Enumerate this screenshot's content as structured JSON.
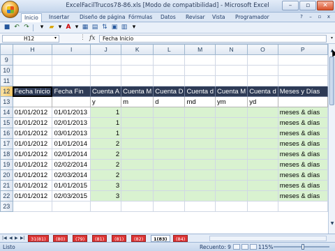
{
  "window": {
    "title": "ExcelFacilTrucos78-86.xls  [Modo de compatibilidad]  -  Microsoft Excel"
  },
  "ribbon": {
    "tabs": [
      "Inicio",
      "Insertar",
      "Diseño de página",
      "Fórmulas",
      "Datos",
      "Revisar",
      "Vista",
      "Programador"
    ]
  },
  "formula_bar": {
    "name_box": "H12",
    "fx": "fx",
    "value": "Fecha Inicio"
  },
  "grid": {
    "columns": [
      "H",
      "I",
      "J",
      "K",
      "L",
      "M",
      "N",
      "O",
      "P"
    ],
    "empty_rows": [
      "9",
      "10",
      "11"
    ],
    "header_row": {
      "row": "12",
      "cells": [
        "Fecha Inicio",
        "Fecha Fin",
        "Cuenta A",
        "Cuenta M",
        "Cuenta D",
        "Cuenta d",
        "Cuenta M",
        "Cuenta d",
        "Meses y Días"
      ]
    },
    "sub_row": {
      "row": "13",
      "cells": [
        "",
        "",
        "y",
        "m",
        "d",
        "md",
        "ym",
        "yd",
        ""
      ]
    },
    "data_rows": [
      {
        "row": "14",
        "start": "01/01/2012",
        "end": "01/01/2013",
        "years": "1",
        "text": "meses &  días"
      },
      {
        "row": "15",
        "start": "01/01/2012",
        "end": "02/01/2013",
        "years": "1",
        "text": "meses &  días"
      },
      {
        "row": "16",
        "start": "01/01/2012",
        "end": "03/01/2013",
        "years": "1",
        "text": "meses &  días"
      },
      {
        "row": "17",
        "start": "01/01/2012",
        "end": "01/01/2014",
        "years": "2",
        "text": "meses &  días"
      },
      {
        "row": "18",
        "start": "01/01/2012",
        "end": "02/01/2014",
        "years": "2",
        "text": "meses &  días"
      },
      {
        "row": "19",
        "start": "01/01/2012",
        "end": "02/02/2014",
        "years": "2",
        "text": "meses &  días"
      },
      {
        "row": "20",
        "start": "01/01/2012",
        "end": "02/03/2014",
        "years": "2",
        "text": "meses &  días"
      },
      {
        "row": "21",
        "start": "01/01/2012",
        "end": "01/01/2015",
        "years": "3",
        "text": "meses &  días"
      },
      {
        "row": "22",
        "start": "01/01/2012",
        "end": "02/03/2015",
        "years": "3",
        "text": "meses &  días"
      }
    ],
    "trailing_rows": [
      "23"
    ],
    "colors": {
      "header_bg": "#2d3a55",
      "input_bg": "#d9f2d0"
    }
  },
  "sheet_tabs": {
    "tabs": [
      "31(81)",
      "(80)",
      "(79)",
      "(81)",
      "(81)",
      "(82)",
      "1(83)",
      "(84)"
    ],
    "active": "1(83)"
  },
  "status_bar": {
    "ready": "Listo",
    "count": "Recuento: 9",
    "zoom": "115%"
  }
}
